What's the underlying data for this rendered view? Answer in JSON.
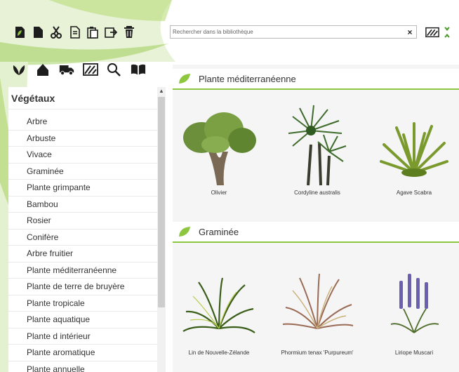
{
  "colors": {
    "accent_green": "#8dc63f",
    "dark_green": "#2d7d32",
    "panel_bg": "#ffffff",
    "content_bg": "#f5f5f5"
  },
  "toolbar": {
    "icons": [
      "new-plant-icon",
      "file-icon",
      "cut-icon",
      "copy-icon",
      "paste-icon",
      "import-icon",
      "trash-icon"
    ],
    "search_placeholder": "Rechercher dans la bibliothèque",
    "search_clear": "×",
    "right_icons": [
      "sort-icon",
      "expand-icon"
    ]
  },
  "category_icons": [
    "plants-icon",
    "house-icon",
    "truck-icon",
    "terrain-icon",
    "search-icon",
    "book-icon"
  ],
  "sidebar": {
    "title": "Végétaux",
    "items": [
      "Arbre",
      "Arbuste",
      "Vivace",
      "Graminée",
      "Plante grimpante",
      "Bambou",
      "Rosier",
      "Conifère",
      "Arbre fruitier",
      "Plante méditerranéenne",
      "Plante de terre de bruyère",
      "Plante tropicale",
      "Plante aquatique",
      "Plante d intérieur",
      "Plante aromatique",
      "Plante annuelle"
    ]
  },
  "sections": [
    {
      "title": "Plante méditerranéenne",
      "plants": [
        "Olivier",
        "Cordyline australis",
        "Agave Scabra"
      ]
    },
    {
      "title": "Graminée",
      "plants": [
        "Lin de Nouvelle-Zélande",
        "Phormium tenax 'Purpureum'",
        "Liriope Muscari"
      ]
    }
  ]
}
